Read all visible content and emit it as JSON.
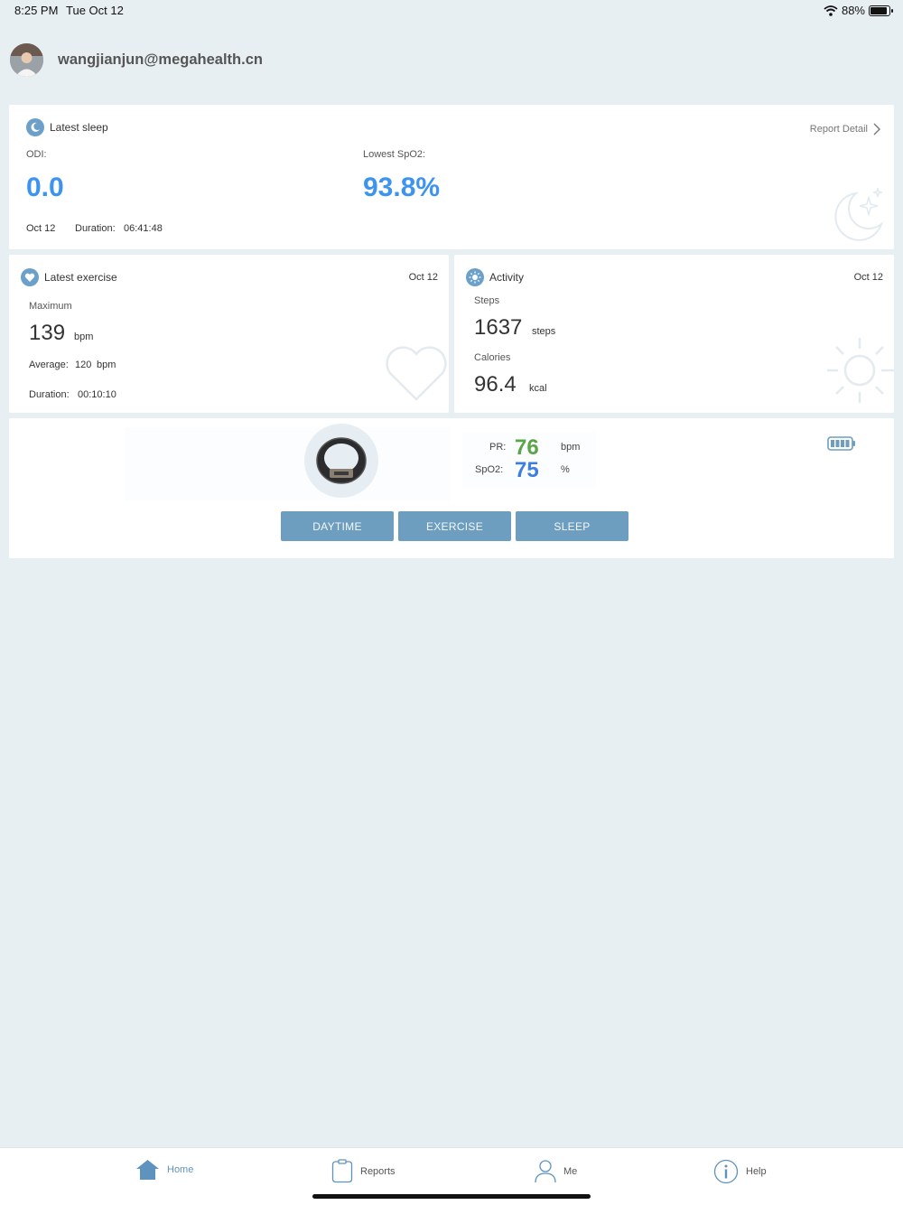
{
  "status_bar": {
    "time": "8:25 PM",
    "date": "Tue Oct 12",
    "battery_pct": "88%",
    "battery_level": 0.88
  },
  "user": {
    "email": "wangjianjun@megahealth.cn"
  },
  "sleep": {
    "title": "Latest sleep",
    "report_detail": "Report Detail",
    "odi_label": "ODI:",
    "odi_value": "0.0",
    "spo2_label": "Lowest SpO2:",
    "spo2_value": "93.8%",
    "date": "Oct 12",
    "duration_label": "Duration:",
    "duration_value": "06:41:48"
  },
  "exercise": {
    "title": "Latest exercise",
    "date": "Oct 12",
    "max_label": "Maximum",
    "max_value": "139",
    "max_unit": "bpm",
    "avg_label": "Average:",
    "avg_value": "120",
    "avg_unit": "bpm",
    "duration_label": "Duration:",
    "duration_value": "00:10:10"
  },
  "activity": {
    "title": "Activity",
    "date": "Oct 12",
    "steps_label": "Steps",
    "steps_value": "1637",
    "steps_unit": "steps",
    "cal_label": "Calories",
    "cal_value": "96.4",
    "cal_unit": "kcal"
  },
  "device": {
    "pr_label": "PR:",
    "pr_value": "76",
    "pr_unit": "bpm",
    "spo2_label": "SpO2:",
    "spo2_value": "75",
    "spo2_unit": "%",
    "pr_color": "#5aa646",
    "spo2_color": "#3c7fe0"
  },
  "modes": {
    "daytime": "DAYTIME",
    "exercise": "EXERCISE",
    "sleep": "SLEEP"
  },
  "tabs": {
    "home": "Home",
    "reports": "Reports",
    "me": "Me",
    "help": "Help"
  },
  "colors": {
    "accent": "#6e9ebf",
    "value_blue": "#3c94f0",
    "icon_blue": "#6aa0c9",
    "background": "#e8eff3"
  },
  "icons": [
    "wifi-icon",
    "battery-icon",
    "moon-icon",
    "heart-icon",
    "sun-icon",
    "ring-device-icon",
    "device-battery-icon",
    "home-icon",
    "reports-icon",
    "me-icon",
    "help-icon",
    "chevron-right-icon"
  ]
}
